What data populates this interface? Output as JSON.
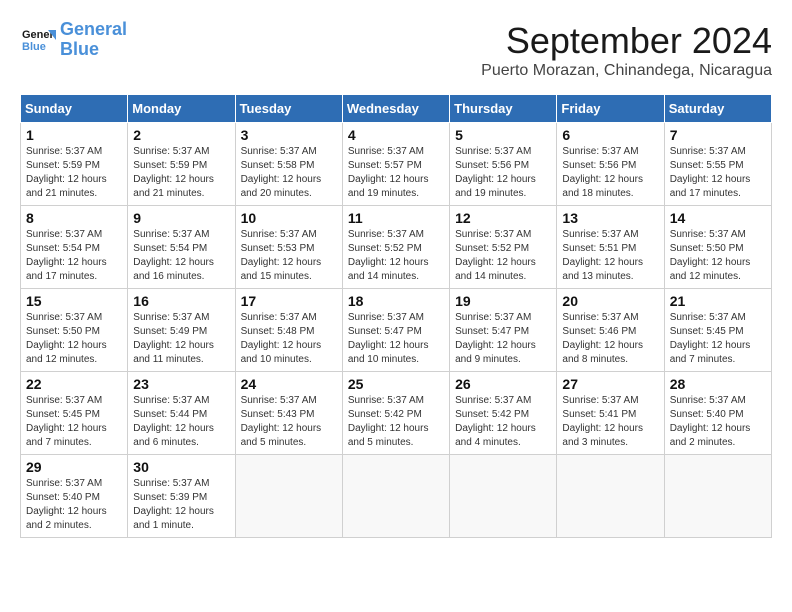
{
  "header": {
    "logo_line1": "General",
    "logo_line2": "Blue",
    "month": "September 2024",
    "location": "Puerto Morazan, Chinandega, Nicaragua"
  },
  "weekdays": [
    "Sunday",
    "Monday",
    "Tuesday",
    "Wednesday",
    "Thursday",
    "Friday",
    "Saturday"
  ],
  "weeks": [
    [
      {
        "day": "1",
        "info": "Sunrise: 5:37 AM\nSunset: 5:59 PM\nDaylight: 12 hours\nand 21 minutes."
      },
      {
        "day": "2",
        "info": "Sunrise: 5:37 AM\nSunset: 5:59 PM\nDaylight: 12 hours\nand 21 minutes."
      },
      {
        "day": "3",
        "info": "Sunrise: 5:37 AM\nSunset: 5:58 PM\nDaylight: 12 hours\nand 20 minutes."
      },
      {
        "day": "4",
        "info": "Sunrise: 5:37 AM\nSunset: 5:57 PM\nDaylight: 12 hours\nand 19 minutes."
      },
      {
        "day": "5",
        "info": "Sunrise: 5:37 AM\nSunset: 5:56 PM\nDaylight: 12 hours\nand 19 minutes."
      },
      {
        "day": "6",
        "info": "Sunrise: 5:37 AM\nSunset: 5:56 PM\nDaylight: 12 hours\nand 18 minutes."
      },
      {
        "day": "7",
        "info": "Sunrise: 5:37 AM\nSunset: 5:55 PM\nDaylight: 12 hours\nand 17 minutes."
      }
    ],
    [
      {
        "day": "8",
        "info": "Sunrise: 5:37 AM\nSunset: 5:54 PM\nDaylight: 12 hours\nand 17 minutes."
      },
      {
        "day": "9",
        "info": "Sunrise: 5:37 AM\nSunset: 5:54 PM\nDaylight: 12 hours\nand 16 minutes."
      },
      {
        "day": "10",
        "info": "Sunrise: 5:37 AM\nSunset: 5:53 PM\nDaylight: 12 hours\nand 15 minutes."
      },
      {
        "day": "11",
        "info": "Sunrise: 5:37 AM\nSunset: 5:52 PM\nDaylight: 12 hours\nand 14 minutes."
      },
      {
        "day": "12",
        "info": "Sunrise: 5:37 AM\nSunset: 5:52 PM\nDaylight: 12 hours\nand 14 minutes."
      },
      {
        "day": "13",
        "info": "Sunrise: 5:37 AM\nSunset: 5:51 PM\nDaylight: 12 hours\nand 13 minutes."
      },
      {
        "day": "14",
        "info": "Sunrise: 5:37 AM\nSunset: 5:50 PM\nDaylight: 12 hours\nand 12 minutes."
      }
    ],
    [
      {
        "day": "15",
        "info": "Sunrise: 5:37 AM\nSunset: 5:50 PM\nDaylight: 12 hours\nand 12 minutes."
      },
      {
        "day": "16",
        "info": "Sunrise: 5:37 AM\nSunset: 5:49 PM\nDaylight: 12 hours\nand 11 minutes."
      },
      {
        "day": "17",
        "info": "Sunrise: 5:37 AM\nSunset: 5:48 PM\nDaylight: 12 hours\nand 10 minutes."
      },
      {
        "day": "18",
        "info": "Sunrise: 5:37 AM\nSunset: 5:47 PM\nDaylight: 12 hours\nand 10 minutes."
      },
      {
        "day": "19",
        "info": "Sunrise: 5:37 AM\nSunset: 5:47 PM\nDaylight: 12 hours\nand 9 minutes."
      },
      {
        "day": "20",
        "info": "Sunrise: 5:37 AM\nSunset: 5:46 PM\nDaylight: 12 hours\nand 8 minutes."
      },
      {
        "day": "21",
        "info": "Sunrise: 5:37 AM\nSunset: 5:45 PM\nDaylight: 12 hours\nand 7 minutes."
      }
    ],
    [
      {
        "day": "22",
        "info": "Sunrise: 5:37 AM\nSunset: 5:45 PM\nDaylight: 12 hours\nand 7 minutes."
      },
      {
        "day": "23",
        "info": "Sunrise: 5:37 AM\nSunset: 5:44 PM\nDaylight: 12 hours\nand 6 minutes."
      },
      {
        "day": "24",
        "info": "Sunrise: 5:37 AM\nSunset: 5:43 PM\nDaylight: 12 hours\nand 5 minutes."
      },
      {
        "day": "25",
        "info": "Sunrise: 5:37 AM\nSunset: 5:42 PM\nDaylight: 12 hours\nand 5 minutes."
      },
      {
        "day": "26",
        "info": "Sunrise: 5:37 AM\nSunset: 5:42 PM\nDaylight: 12 hours\nand 4 minutes."
      },
      {
        "day": "27",
        "info": "Sunrise: 5:37 AM\nSunset: 5:41 PM\nDaylight: 12 hours\nand 3 minutes."
      },
      {
        "day": "28",
        "info": "Sunrise: 5:37 AM\nSunset: 5:40 PM\nDaylight: 12 hours\nand 2 minutes."
      }
    ],
    [
      {
        "day": "29",
        "info": "Sunrise: 5:37 AM\nSunset: 5:40 PM\nDaylight: 12 hours\nand 2 minutes."
      },
      {
        "day": "30",
        "info": "Sunrise: 5:37 AM\nSunset: 5:39 PM\nDaylight: 12 hours\nand 1 minute."
      },
      null,
      null,
      null,
      null,
      null
    ]
  ]
}
